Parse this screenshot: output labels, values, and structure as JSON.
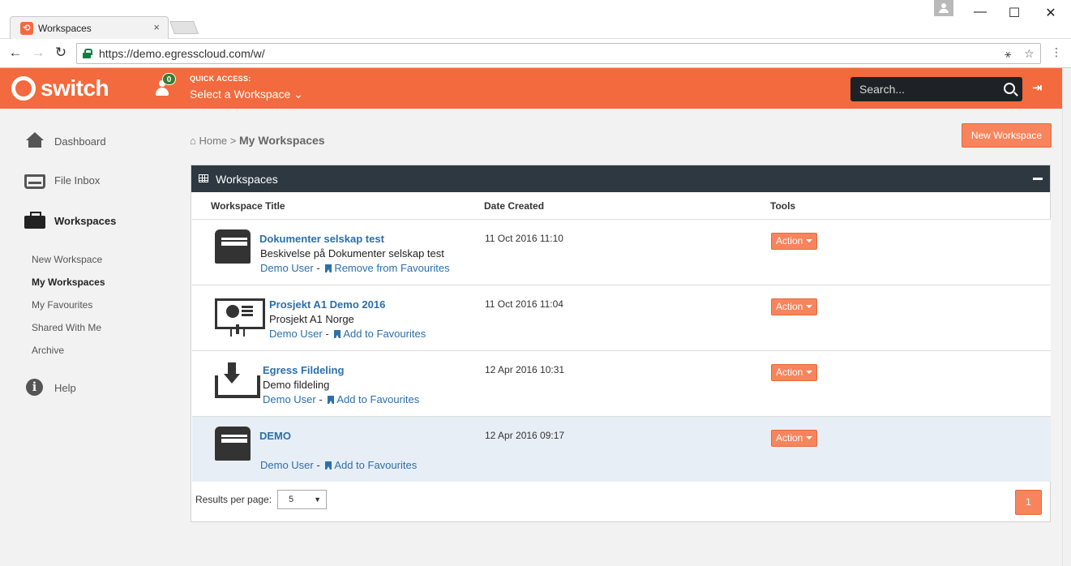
{
  "browser": {
    "tab_title": "Workspaces",
    "tab_close": "×",
    "url": "https://demo.egresscloud.com/w/",
    "window_controls": {
      "minimize": "—",
      "maximize": "☐",
      "close": "✕"
    }
  },
  "header": {
    "logo_text": "switch",
    "notifications_count": "0",
    "quick_access_label": "QUICK ACCESS:",
    "quick_access_select": "Select a Workspace ⌄",
    "search_placeholder": "Search...",
    "accent_color": "#f26a3d"
  },
  "sidebar": {
    "items": [
      {
        "label": "Dashboard",
        "icon": "home-icon"
      },
      {
        "label": "File Inbox",
        "icon": "inbox-icon"
      },
      {
        "label": "Workspaces",
        "icon": "briefcase-icon"
      },
      {
        "label": "Help",
        "icon": "info-icon"
      }
    ],
    "sub_items": [
      "New Workspace",
      "My Workspaces",
      "My Favourites",
      "Shared With Me",
      "Archive"
    ]
  },
  "breadcrumb": {
    "home": "Home",
    "separator": ">",
    "current": "My Workspaces"
  },
  "new_workspace_button": "New Workspace",
  "panel": {
    "title": "Workspaces",
    "columns": [
      "Workspace Title",
      "Date Created",
      "Tools"
    ],
    "rows": [
      {
        "title": "Dokumenter selskap test",
        "description": "Beskivelse på Dokumenter selskap test",
        "owner": "Demo User",
        "sep": " - ",
        "favourite_link": "Remove from Favourites",
        "date": "11 Oct 2016 11:10",
        "action": "Action",
        "icon": "cabinet-icon"
      },
      {
        "title": "Prosjekt A1 Demo 2016",
        "description": "Prosjekt A1 Norge",
        "owner": "Demo User",
        "sep": " - ",
        "favourite_link": "Add to Favourites",
        "date": "11 Oct 2016 11:04",
        "action": "Action",
        "icon": "presentation-icon"
      },
      {
        "title": "Egress Fildeling",
        "description": "Demo fildeling",
        "owner": "Demo User",
        "sep": " - ",
        "favourite_link": "Add to Favourites",
        "date": "12 Apr 2016 10:31",
        "action": "Action",
        "icon": "download-icon"
      },
      {
        "title": "DEMO",
        "description": "",
        "owner": "Demo User",
        "sep": " - ",
        "favourite_link": "Add to Favourites",
        "date": "12 Apr 2016 09:17",
        "action": "Action",
        "icon": "cabinet-icon"
      }
    ],
    "results_per_page_label": "Results per page:",
    "results_per_page_value": "5",
    "current_page": "1"
  }
}
